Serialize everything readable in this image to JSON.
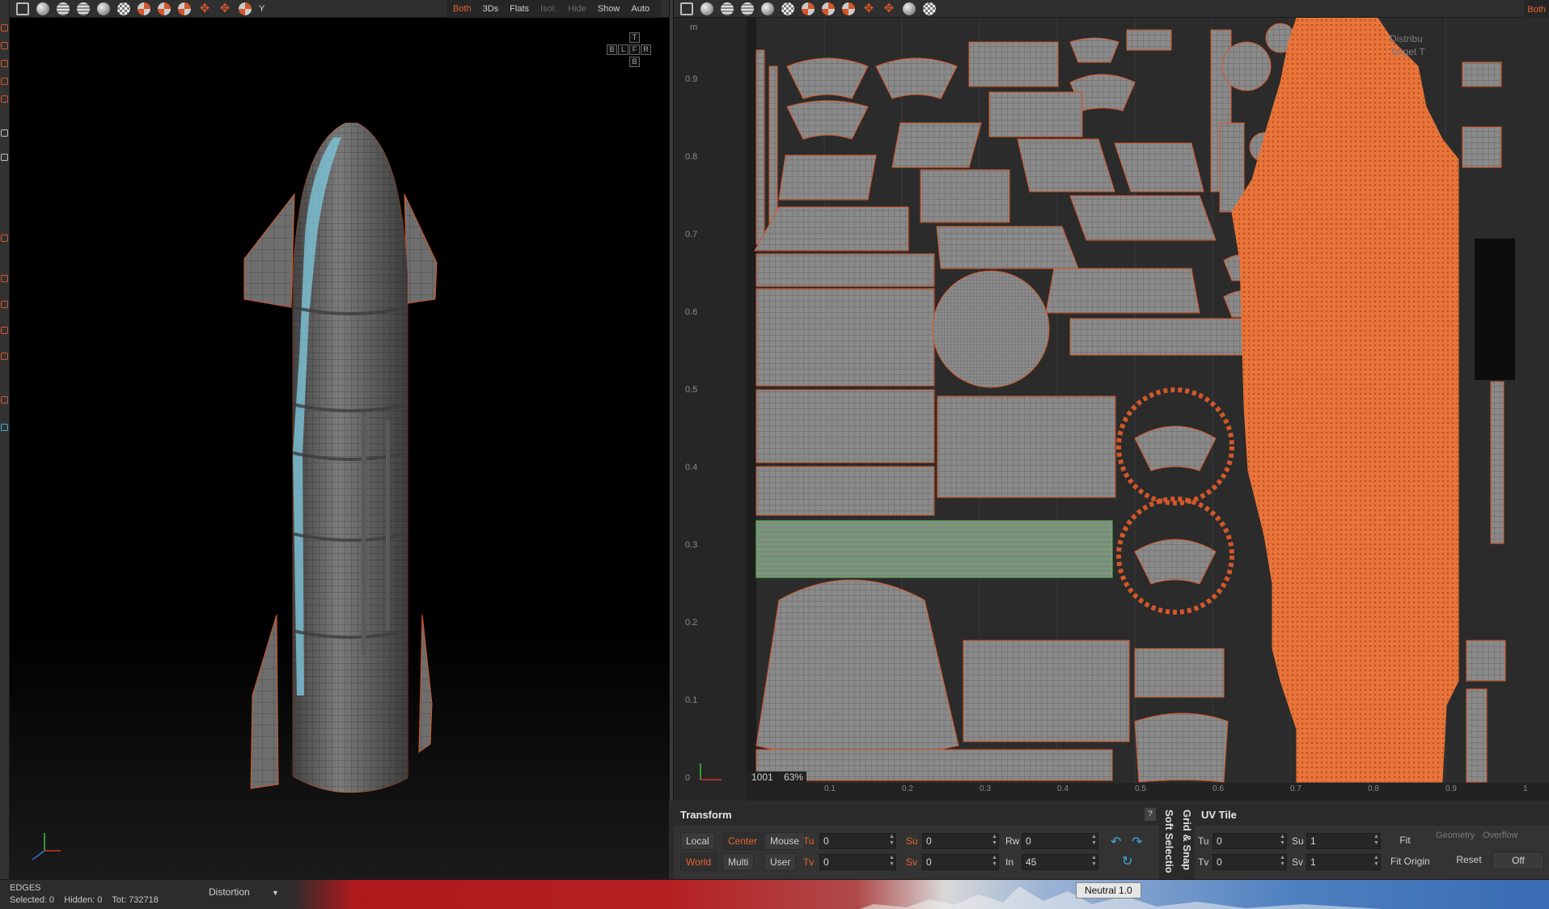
{
  "viewport3d": {
    "toolbar": {
      "both_label": "Both",
      "threeds_label": "3Ds",
      "flats_label": "Flats",
      "isol_label": "Isol.",
      "hide_label": "Hide",
      "show_label": "Show",
      "auto_label": "Auto",
      "axis_label": "Y"
    },
    "view_cube": {
      "top": "T",
      "bottom": "B",
      "back": "B",
      "left": "L",
      "front": "F",
      "right": "R"
    }
  },
  "viewportUV": {
    "toolbar": {
      "both_label": "Both"
    },
    "corner_label": "m",
    "info_line1": "Distribu",
    "info_line2": "Target T",
    "tile_id": "1001",
    "zoom": "63%",
    "ruler_left": [
      "0.9",
      "0.8",
      "0.7",
      "0.6",
      "0.5",
      "0.4",
      "0.3",
      "0.2",
      "0.1",
      "0"
    ],
    "ruler_bottom": [
      "0.1",
      "0.2",
      "0.3",
      "0.4",
      "0.5",
      "0.6",
      "0.7",
      "0.8",
      "0.9",
      "1"
    ]
  },
  "transform": {
    "title": "Transform",
    "local": "Local",
    "center": "Center",
    "mouse": "Mouse",
    "world": "World",
    "multi": "Multi",
    "user": "User",
    "tu_label": "Tu",
    "tu_value": "0",
    "tv_label": "Tv",
    "tv_value": "0",
    "su_label": "Su",
    "su_value": "0",
    "sv_label": "Sv",
    "sv_value": "0",
    "rw_label": "Rw",
    "rw_value": "0",
    "in_label": "In",
    "in_value": "45",
    "help": "?"
  },
  "tabs": {
    "soft_selection": "Soft Selectio",
    "grid_snap": "Grid & Snap"
  },
  "uvtile": {
    "title": "UV Tile",
    "tu_label": "Tu",
    "tu_value": "0",
    "tv_label": "Tv",
    "tv_value": "0",
    "su_label": "Su",
    "su_value": "1",
    "sv_label": "Sv",
    "sv_value": "1",
    "fit": "Fit",
    "fit_origin": "Fit Origin",
    "reset": "Reset",
    "geometry": "Geometry",
    "overflow": "Overflow",
    "off": "Off"
  },
  "status": {
    "mode": "EDGES",
    "selected": "Selected: 0",
    "hidden": "Hidden: 0",
    "total": "Tot: 732718",
    "distortion": "Distortion",
    "neutral": "Neutral 1.0"
  },
  "colors": {
    "accent": "#e5632f",
    "selection": "#e8743a",
    "bg_uv": "#2a2a2a"
  }
}
